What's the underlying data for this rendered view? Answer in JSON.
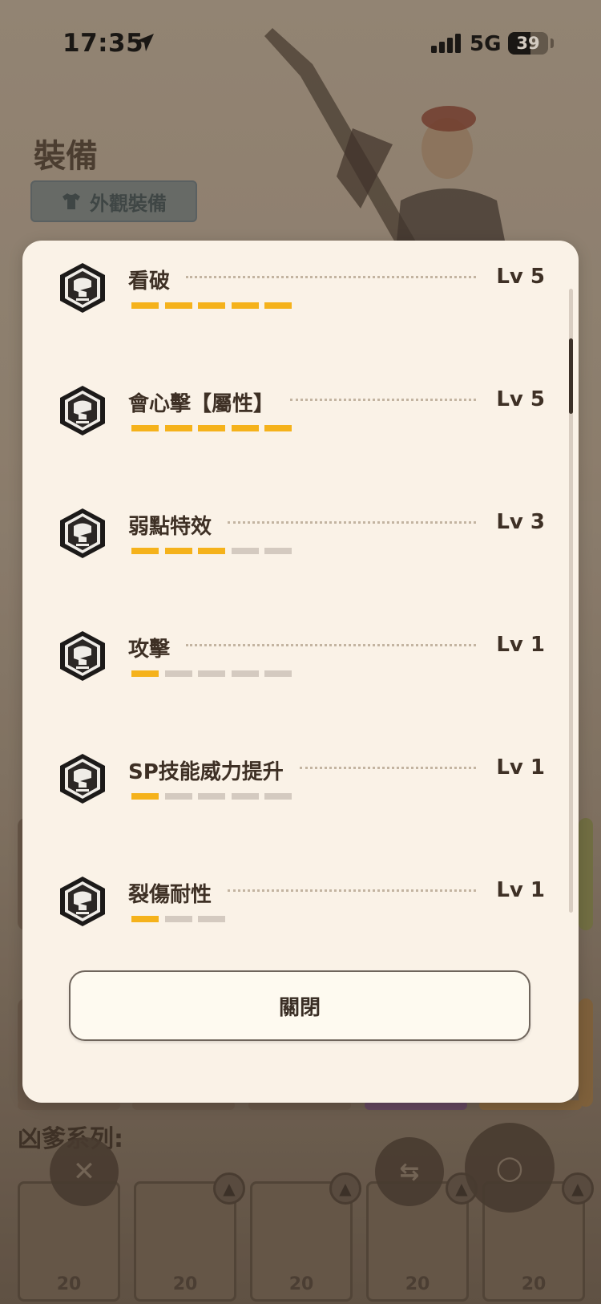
{
  "status_bar": {
    "time": "17:35",
    "network": "5G",
    "battery": "39"
  },
  "page": {
    "title": "裝備",
    "appearance_button": "外觀裝備"
  },
  "background": {
    "series_heading": "凶爹系列:",
    "slots": [
      {
        "level": "20"
      },
      {
        "level": "20"
      },
      {
        "level": "20"
      },
      {
        "level": "20"
      },
      {
        "level": "20"
      }
    ]
  },
  "modal": {
    "skills": [
      {
        "name": "看破",
        "level": "Lv 5",
        "max_level": 5,
        "current_level": 5
      },
      {
        "name": "會心擊【屬性】",
        "level": "Lv 5",
        "max_level": 5,
        "current_level": 5
      },
      {
        "name": "弱點特效",
        "level": "Lv 3",
        "max_level": 5,
        "current_level": 3
      },
      {
        "name": "攻擊",
        "level": "Lv 1",
        "max_level": 5,
        "current_level": 1
      },
      {
        "name": "SP技能威力提升",
        "level": "Lv 1",
        "max_level": 5,
        "current_level": 1
      },
      {
        "name": "裂傷耐性",
        "level": "Lv 1",
        "max_level": 3,
        "current_level": 1
      }
    ],
    "close_label": "關閉"
  },
  "colors": {
    "accent": "#f5b21b",
    "bar_empty": "#d4cac0",
    "modal_bg": "#faf2e7",
    "text_dark": "#3e3025"
  },
  "icons": {
    "skill": "hex-skill-icon",
    "location": "location-arrow-icon",
    "signal": "signal-bars-icon"
  }
}
